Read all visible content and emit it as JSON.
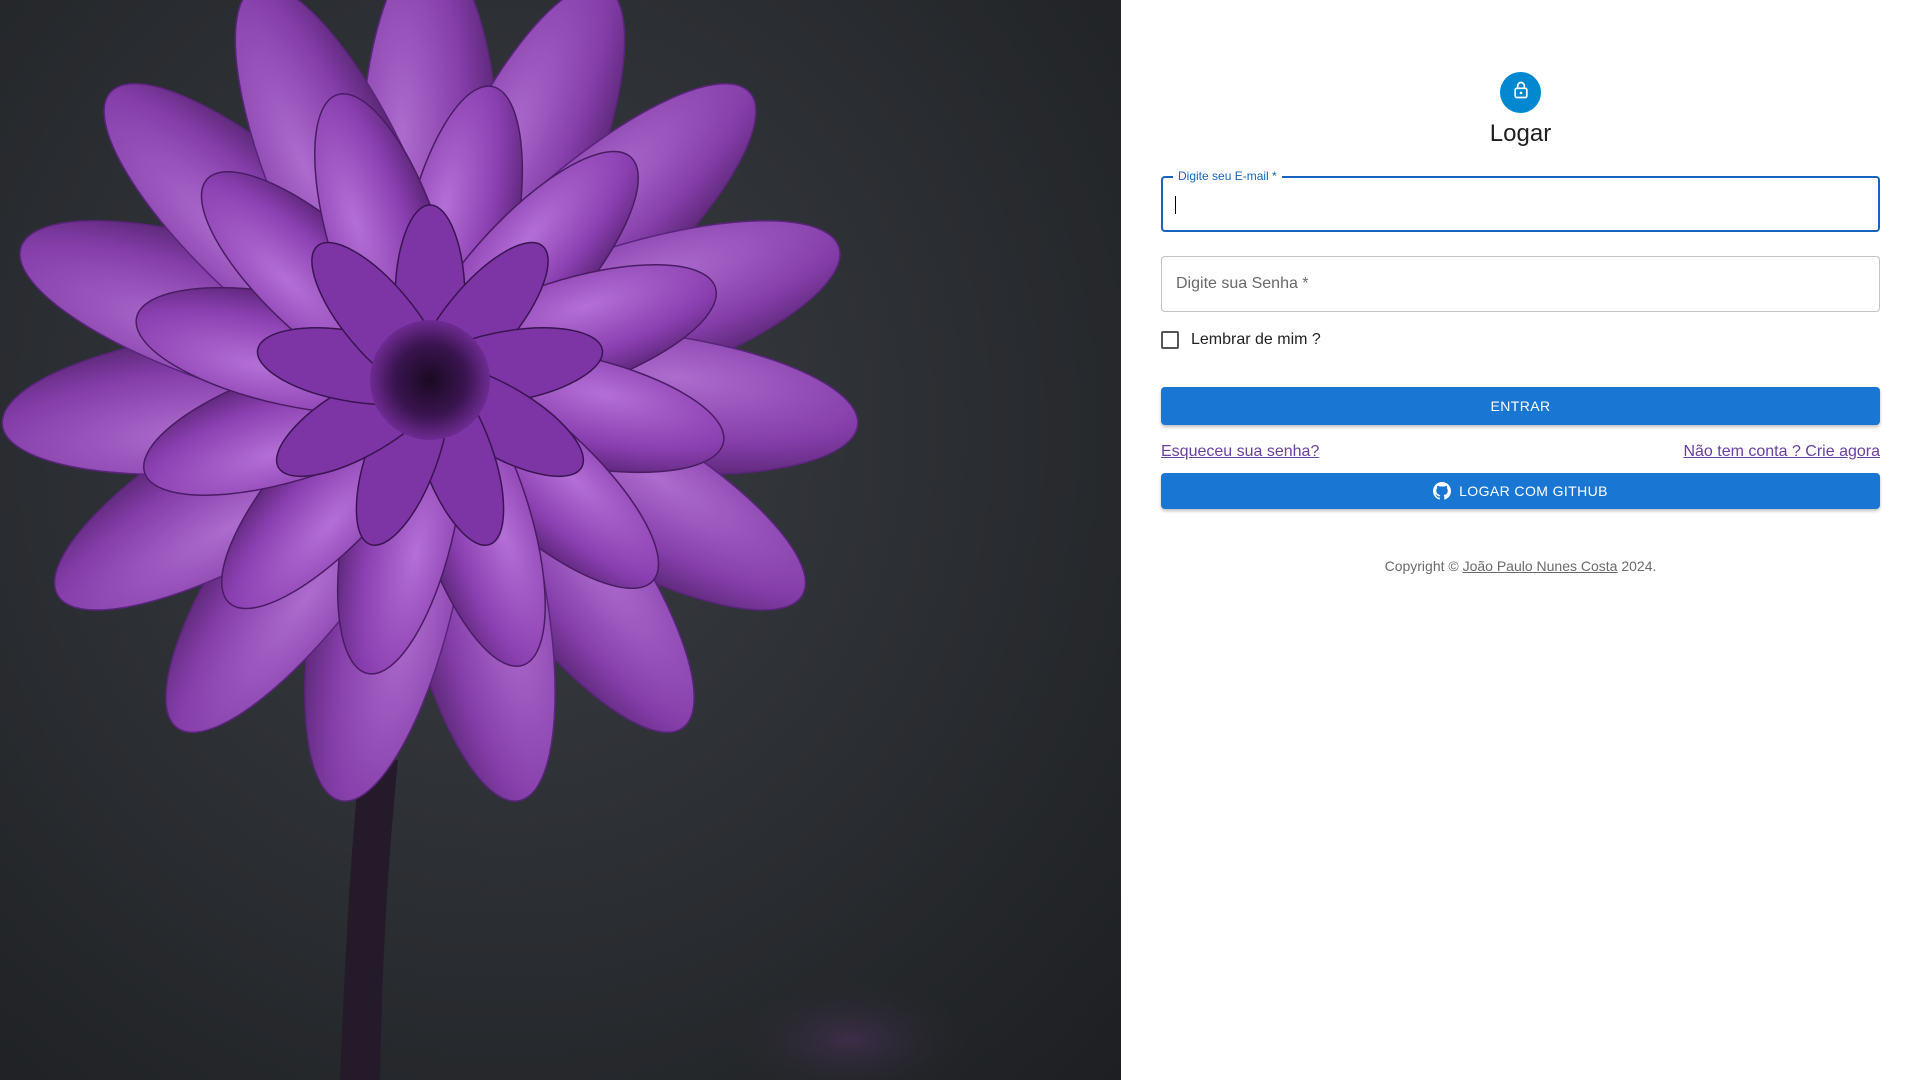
{
  "hero": {
    "image_icon": "purple-dahlia-flower-image"
  },
  "login": {
    "icon": "lock-icon",
    "title": "Logar",
    "email": {
      "label": "Digite seu E-mail *",
      "value": ""
    },
    "password": {
      "label": "Digite sua Senha  *",
      "value": ""
    },
    "remember_label": "Lembrar de mim ?",
    "enter_button": "ENTRAR",
    "forgot_link": "Esqueceu sua senha?",
    "signup_link": "Não tem conta ? Crie agora",
    "github_button": "LOGAR COM GITHUB",
    "github_icon": "github-icon"
  },
  "footer": {
    "prefix": "Copyright © ",
    "author": "João Paulo Nunes Costa",
    "suffix": " 2024."
  },
  "colors": {
    "primary": "#1976d2",
    "avatar": "#0288d1",
    "link": "#6a3fa0",
    "hero_bg": "#2a2d31"
  }
}
